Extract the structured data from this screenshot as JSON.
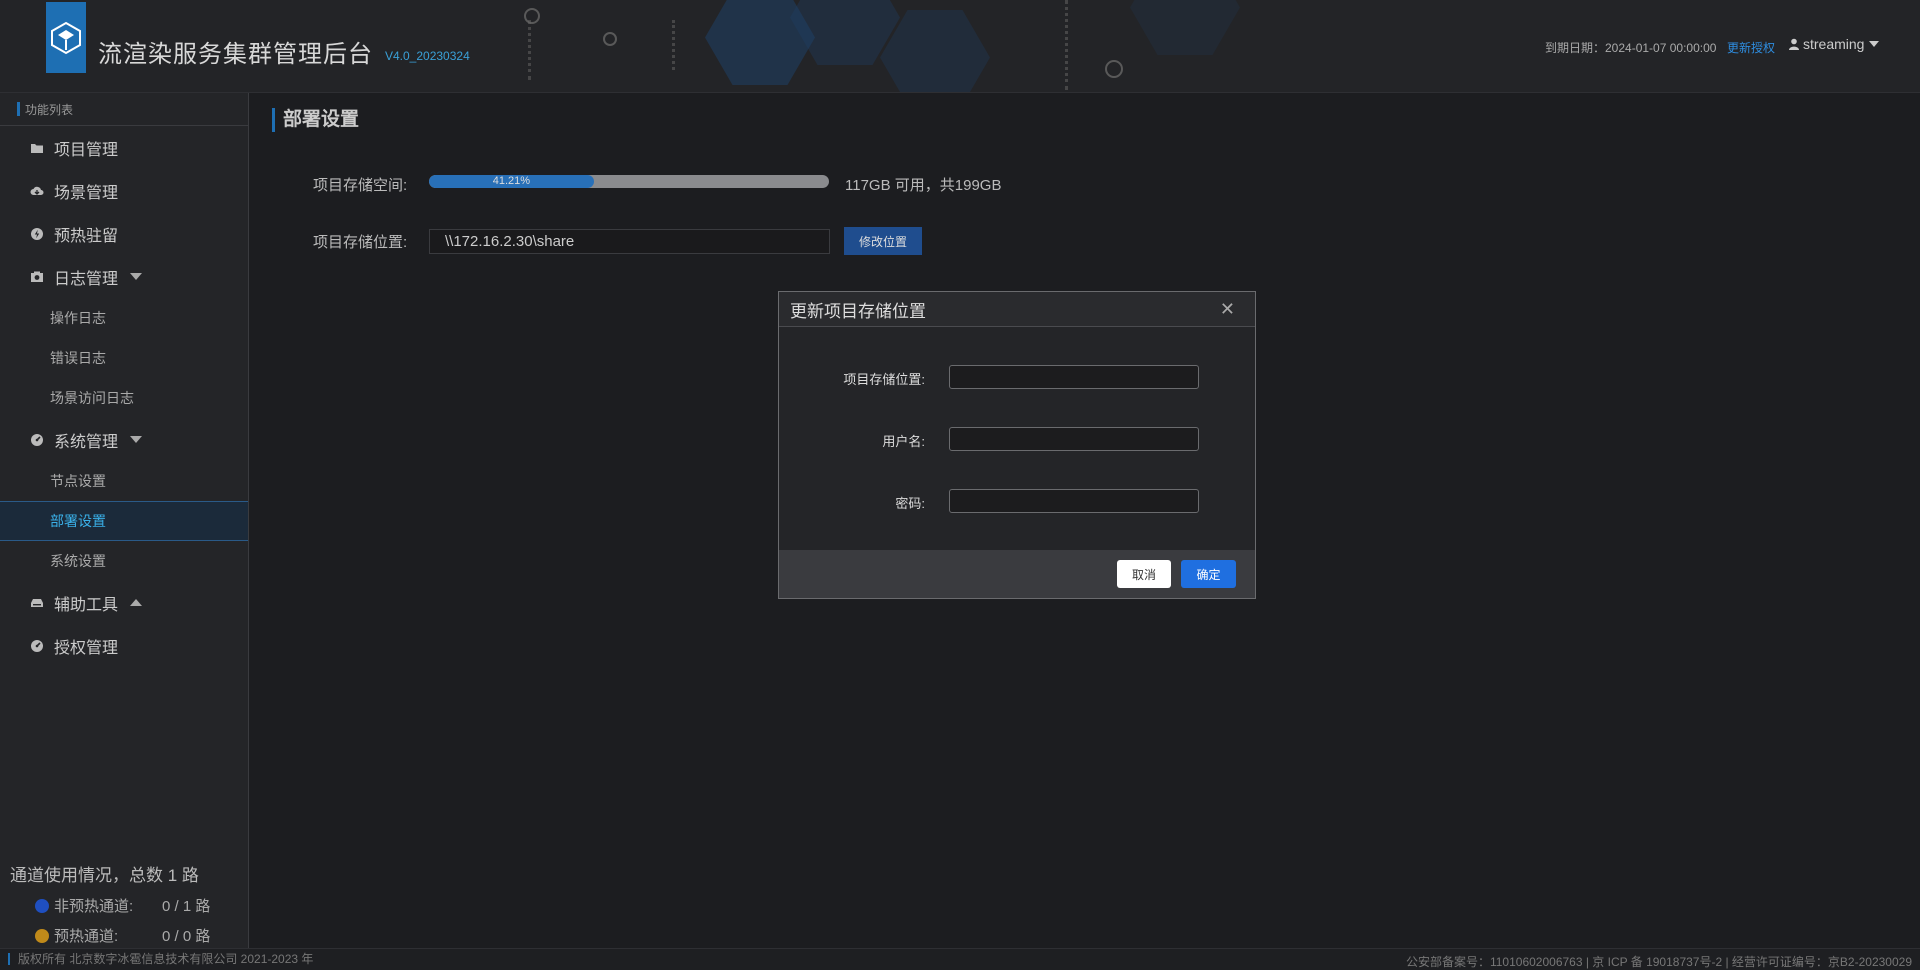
{
  "header": {
    "app_title": "流渲染服务集群管理后台",
    "version": "V4.0_20230324",
    "expire_label": "到期日期：2024-01-07 00:00:00",
    "renew_link": "更新授权",
    "username": "streaming"
  },
  "sidebar": {
    "heading": "功能列表",
    "items": [
      {
        "label": "项目管理",
        "icon": "folder-icon"
      },
      {
        "label": "场景管理",
        "icon": "cloud-icon"
      },
      {
        "label": "预热驻留",
        "icon": "bolt-icon"
      },
      {
        "label": "日志管理",
        "icon": "camera-icon",
        "expanded": true,
        "children": [
          "操作日志",
          "错误日志",
          "场景访问日志"
        ]
      },
      {
        "label": "系统管理",
        "icon": "gauge-icon",
        "expanded": true,
        "children": [
          "节点设置",
          "部署设置",
          "系统设置"
        ]
      },
      {
        "label": "辅助工具",
        "icon": "inbox-icon",
        "expanded": false
      },
      {
        "label": "授权管理",
        "icon": "gauge-icon"
      }
    ],
    "active_child": "部署设置"
  },
  "channels": {
    "title": "通道使用情况，总数 1 路",
    "rows": [
      {
        "label": "非预热通道:",
        "value": "0 / 1 路",
        "color": "#1f4fc0"
      },
      {
        "label": "预热通道:",
        "value": "0 / 0 路",
        "color": "#c08a1a"
      }
    ]
  },
  "main": {
    "title": "部署设置",
    "storage_label": "项目存储空间:",
    "storage_used_fraction": 0.4121,
    "storage_percent_text": "41.21%",
    "storage_avail": "117GB 可用，共199GB",
    "location_label": "项目存储位置:",
    "location_value": "\\\\172.16.2.30\\share",
    "modify_button": "修改位置"
  },
  "dialog": {
    "title": "更新项目存储位置",
    "fields": [
      {
        "label": "项目存储位置:",
        "value": "",
        "placeholder": ""
      },
      {
        "label": "用户名:",
        "value": "",
        "placeholder": ""
      },
      {
        "label": "密码:",
        "value": "",
        "placeholder": ""
      }
    ],
    "cancel": "取消",
    "ok": "确定"
  },
  "footer": {
    "copyright": "版权所有 北京数字冰雹信息技术有限公司 2021-2023 年",
    "records": "公安部备案号：11010602006763 | 京 ICP 备 19018737号-2 | 经营许可证编号：京B2-20230029"
  },
  "colors": {
    "accent": "#1e6fb3",
    "link": "#2e8de0",
    "ok_button": "#1f6fe0"
  }
}
